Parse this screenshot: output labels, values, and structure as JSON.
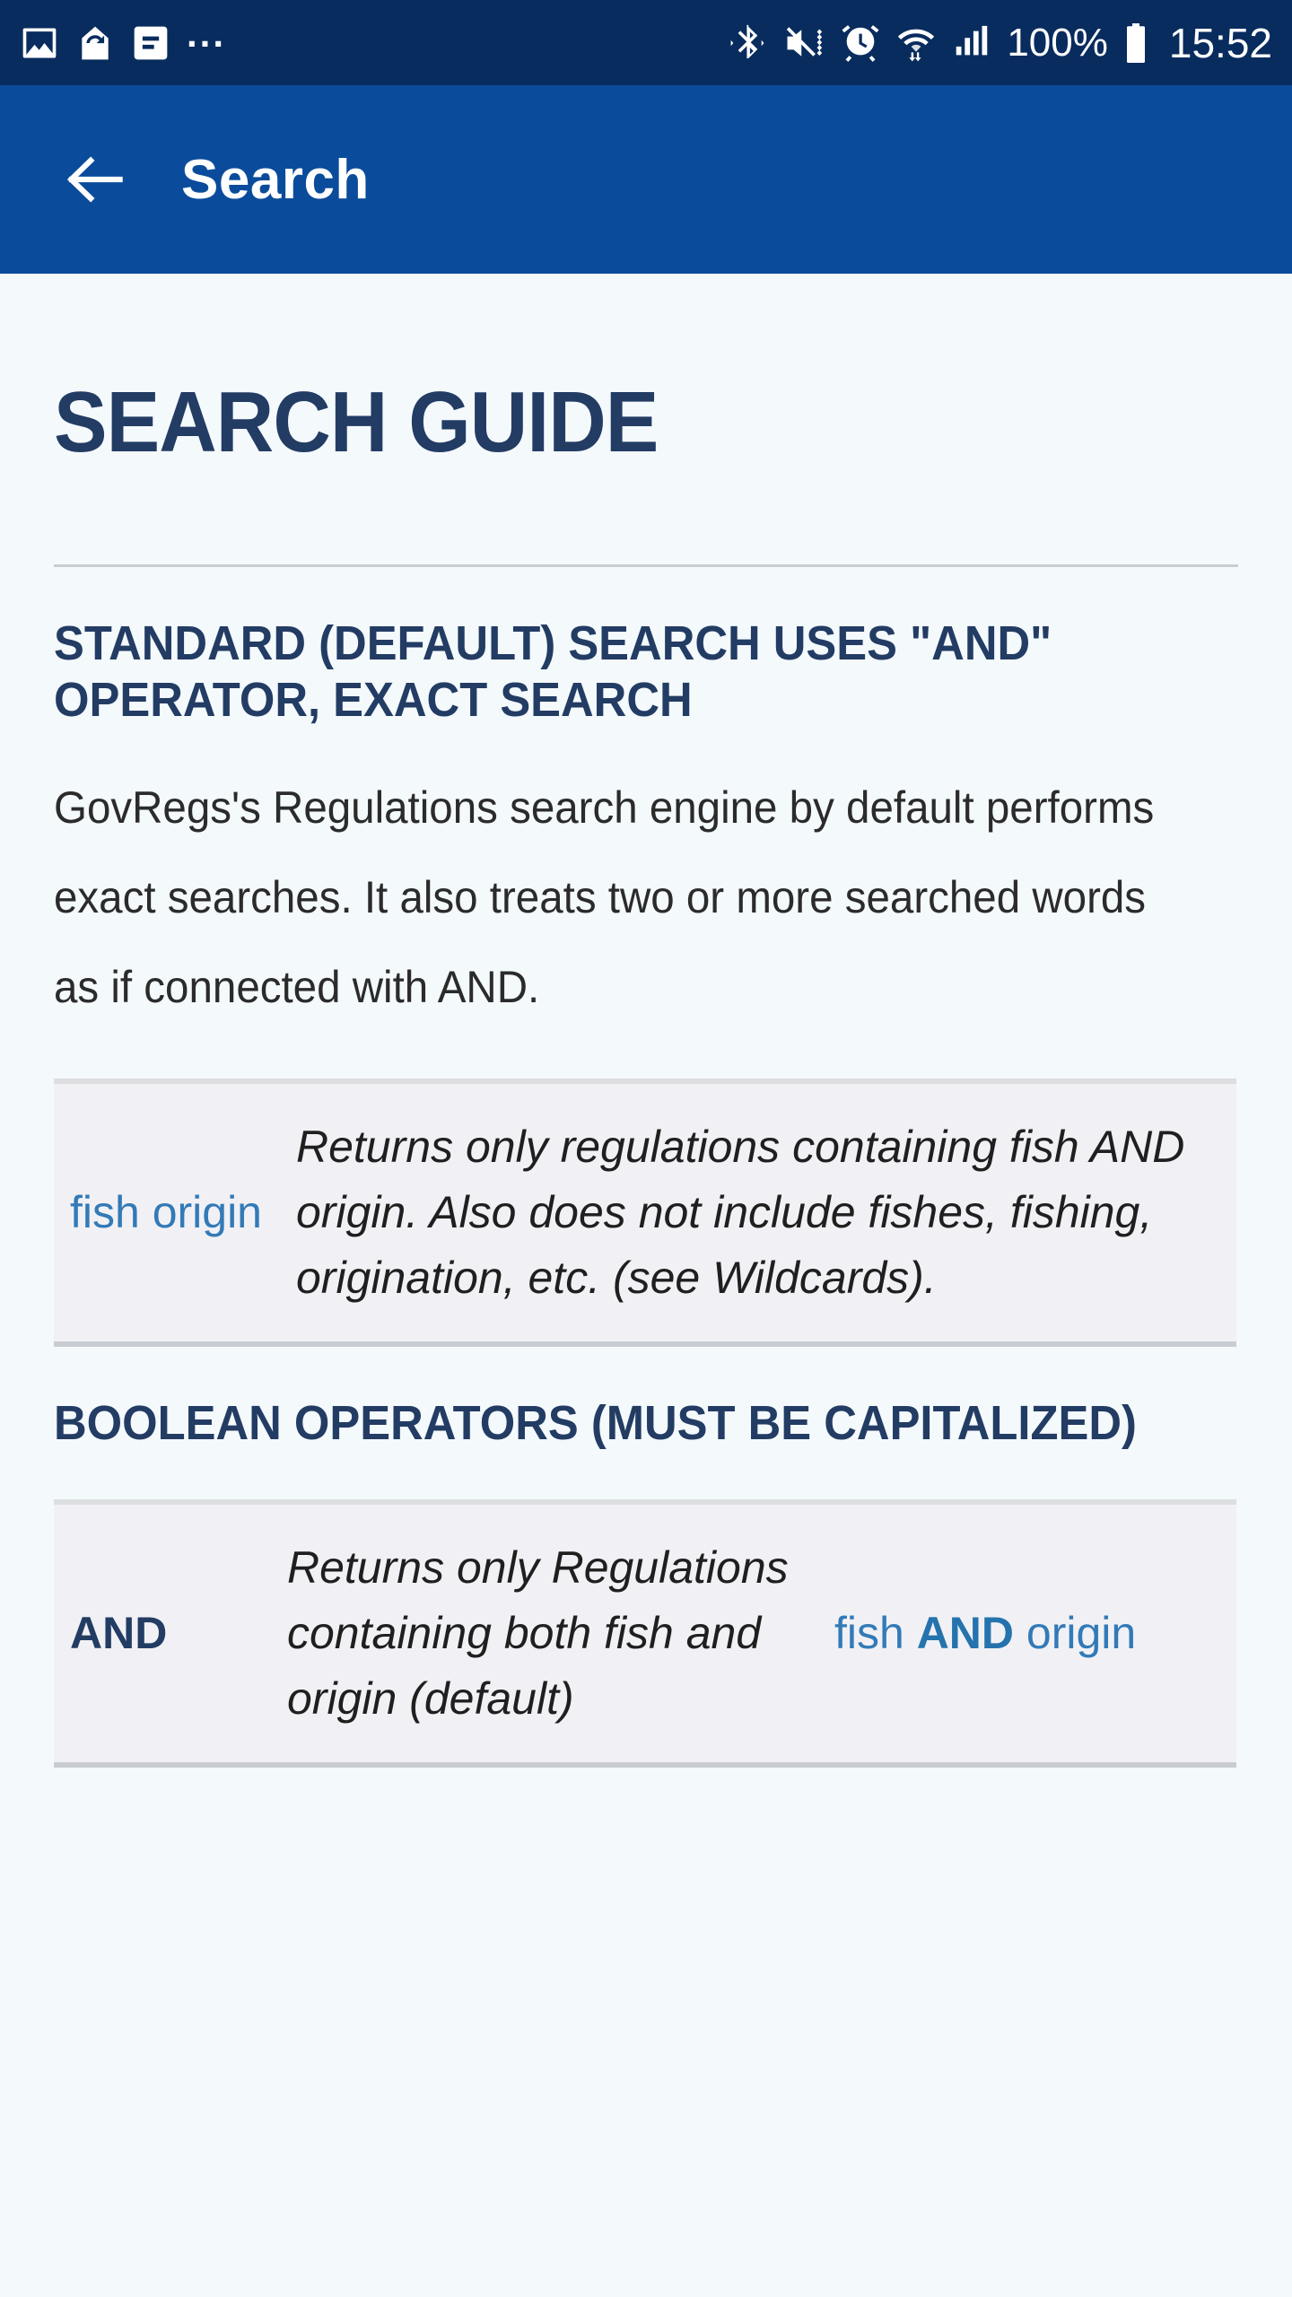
{
  "status_bar": {
    "left_icons": [
      "image-icon",
      "sync-icon",
      "message-icon"
    ],
    "overflow": "...",
    "right_icons": [
      "bluetooth-icon",
      "mute-vibrate-icon",
      "alarm-icon",
      "wifi-icon",
      "signal-icon"
    ],
    "battery_percent": "100%",
    "battery_icon": "battery-full-icon",
    "clock": "15:52"
  },
  "app_bar": {
    "back_icon": "arrow-left-icon",
    "title": "Search",
    "background": "#0a4c9b"
  },
  "page": {
    "title": "SEARCH GUIDE",
    "background": "#f4f9fc",
    "heading_color": "#233c64",
    "link_color": "#337ab7"
  },
  "sections": [
    {
      "heading": "STANDARD (DEFAULT) SEARCH USES \"AND\" OPERATOR, EXACT SEARCH",
      "paragraph": "GovRegs's Regulations search engine by default performs exact searches. It also treats two or more searched words as if connected with AND.",
      "table": {
        "rows": [
          {
            "term": "fish origin",
            "description": "Returns only regulations containing fish AND origin. Also does not include fishes, fishing, origination, etc. (see Wildcards)."
          }
        ]
      }
    },
    {
      "heading": "BOOLEAN OPERATORS (MUST BE CAPITALIZED)",
      "table": {
        "rows": [
          {
            "operator": "AND",
            "description": "Returns only Regulations containing both fish and origin (default)",
            "example_prefix": "fish ",
            "example_operator": "AND",
            "example_suffix": " origin"
          }
        ]
      }
    }
  ]
}
